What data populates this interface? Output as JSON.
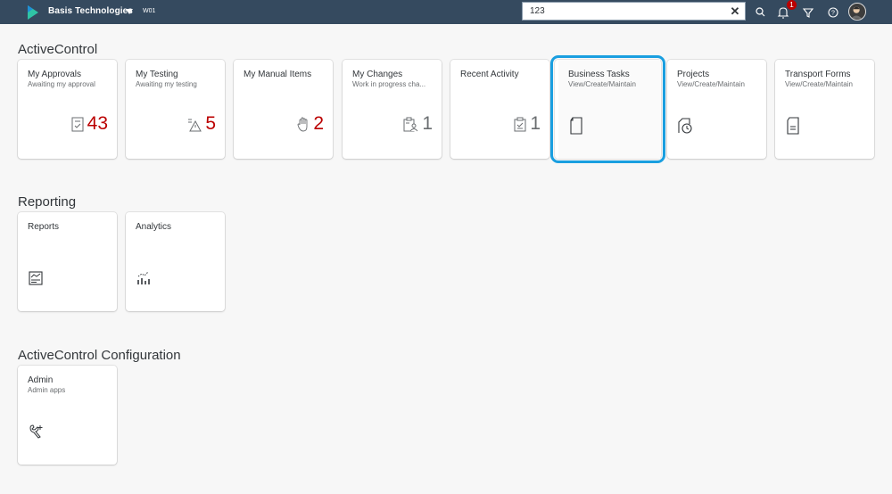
{
  "shell": {
    "brand": "Basis Technologies",
    "system": "W01",
    "search_value": "123",
    "notification_count": "1"
  },
  "sections": {
    "activecontrol": {
      "title": "ActiveControl",
      "tiles": [
        {
          "title": "My Approvals",
          "subtitle": "Awaiting my approval",
          "count": "43",
          "icon": "approval-doc-icon"
        },
        {
          "title": "My Testing",
          "subtitle": "Awaiting my testing",
          "count": "5",
          "icon": "testing-warning-icon"
        },
        {
          "title": "My Manual Items",
          "subtitle": "",
          "count": "2",
          "icon": "hand-icon"
        },
        {
          "title": "My Changes",
          "subtitle": "Work in progress cha...",
          "count": "1",
          "icon": "clipboard-person-icon"
        },
        {
          "title": "Recent Activity",
          "subtitle": "",
          "count": "1",
          "icon": "clipboard-check-icon"
        },
        {
          "title": "Business Tasks",
          "subtitle": "View/Create/Maintain",
          "icon": "document-icon"
        },
        {
          "title": "Projects",
          "subtitle": "View/Create/Maintain",
          "icon": "folder-clock-icon"
        },
        {
          "title": "Transport Forms",
          "subtitle": "View/Create/Maintain",
          "icon": "form-icon"
        }
      ]
    },
    "reporting": {
      "title": "Reporting",
      "tiles": [
        {
          "title": "Reports",
          "subtitle": "",
          "icon": "report-icon"
        },
        {
          "title": "Analytics",
          "subtitle": "",
          "icon": "analytics-icon"
        }
      ]
    },
    "config": {
      "title": "ActiveControl Configuration",
      "tiles": [
        {
          "title": "Admin",
          "subtitle": "Admin apps",
          "icon": "admin-tools-icon"
        }
      ]
    }
  },
  "colors": {
    "shellbar": "#354a5f",
    "kpi_critical": "#bb0000",
    "focus_outline": "#1a9fe0"
  }
}
